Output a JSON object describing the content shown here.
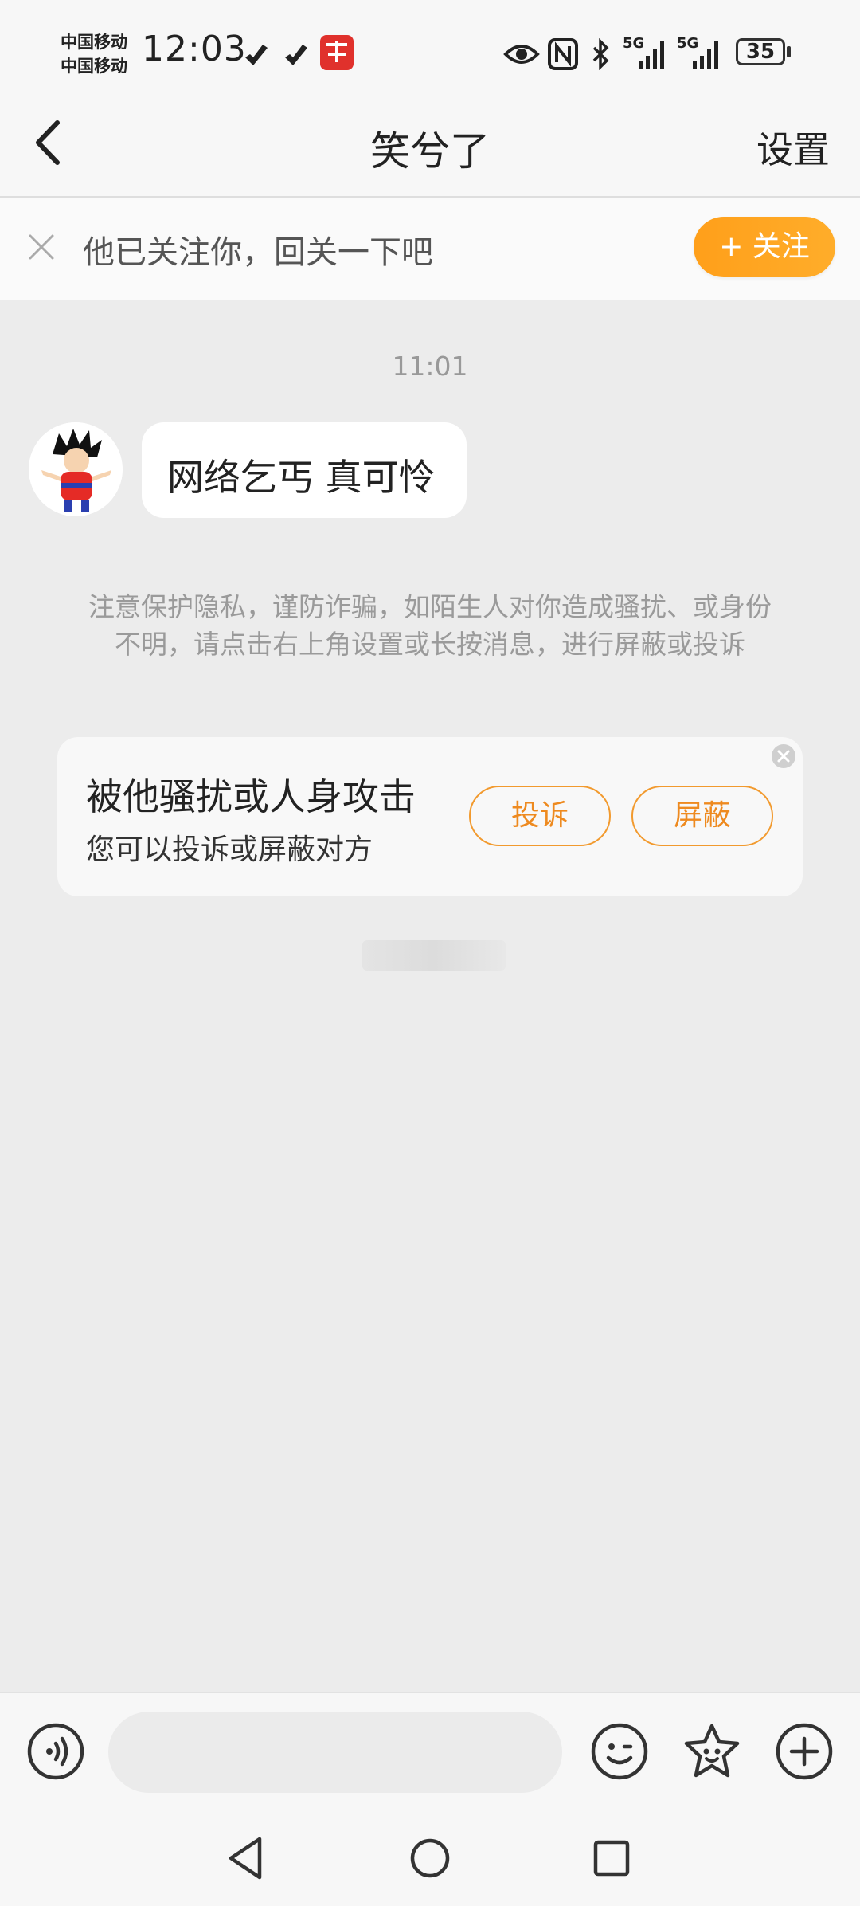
{
  "status_bar": {
    "carrier_1": "中国移动",
    "carrier_2": "中国移动",
    "time": "12:03",
    "battery": "35",
    "network_1": "5G",
    "network_2": "5G",
    "icons": [
      "tiktok-icon",
      "tiktok-icon",
      "app-badge-icon",
      "eye-icon",
      "nfc-icon",
      "bluetooth-icon",
      "signal-icon",
      "signal-icon",
      "battery-icon"
    ]
  },
  "header": {
    "title": "笑兮了",
    "settings_label": "设置",
    "back_icon": "back-arrow-icon"
  },
  "follow_banner": {
    "text": "他已关注你，回关一下吧",
    "button_label": "+ 关注",
    "close_icon": "close-icon"
  },
  "chat": {
    "timestamp": "11:01",
    "messages": [
      {
        "sender": "other",
        "text": "网络乞丐 真可怜"
      }
    ],
    "privacy_notice": "注意保护隐私，谨防诈骗，如陌生人对你造成骚扰、或身份不明，请点击右上角设置或长按消息，进行屏蔽或投诉"
  },
  "report_card": {
    "title": "被他骚扰或人身攻击",
    "subtitle": "您可以投诉或屏蔽对方",
    "report_label": "投诉",
    "block_label": "屏蔽"
  },
  "input_bar": {
    "placeholder": "",
    "icons": [
      "voice-icon",
      "emoji-icon",
      "sticker-icon",
      "plus-icon"
    ]
  },
  "colors": {
    "accent": "#ff9f1a",
    "background": "#ececec",
    "bubble": "#ffffff",
    "muted_text": "#9a9a9a"
  }
}
